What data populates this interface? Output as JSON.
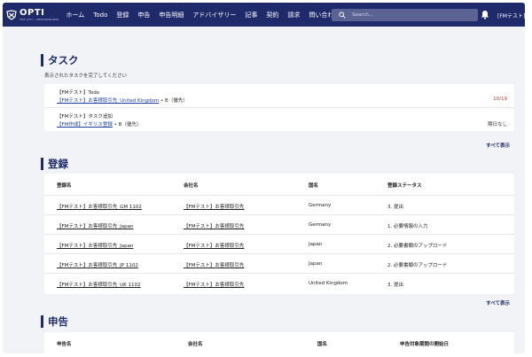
{
  "nav": {
    "logo_word": "OPTI",
    "logo_tagline": "THE CITY • PERFORMANCE",
    "menu": [
      "ホーム",
      "Todo",
      "登録",
      "申告",
      "申告明細",
      "アドバイザリー",
      "記事",
      "契約",
      "請求"
    ],
    "more_label": "問い合わせ",
    "search_placeholder": "Search...",
    "user_label": "[FMテスト]"
  },
  "tasks": {
    "title": "タスク",
    "subtitle": "表示されたタスクを完了してください",
    "items": [
      {
        "title": "【FMテスト】Todo",
        "link": "【FMテスト】お客様取引先_United Kingdom",
        "meta": "• B（優先）",
        "badge": "10/19"
      },
      {
        "title": "【FMテスト】タスク追加",
        "link": "【FM作成】イギリス登録",
        "meta": "• B（優先）",
        "badge": "期日なし"
      }
    ],
    "show_all": "すべて表示"
  },
  "registrations": {
    "title": "登録",
    "headers": [
      "登録名",
      "会社名",
      "国名",
      "登録ステータス"
    ],
    "rows": [
      {
        "name": "【FMテスト】お客様取引先_GM 1102",
        "company": "【FMテスト】お客様取引先",
        "country": "Germany",
        "status": "3. 提出"
      },
      {
        "name": "【FMテスト】お客様取引先_Japan",
        "company": "【FMテスト】お客様取引先",
        "country": "Germany",
        "status": "1. 必要情報の入力"
      },
      {
        "name": "【FMテスト】お客様取引先_Japan",
        "company": "【FMテスト】お客様取引先",
        "country": "Japan",
        "status": "2. 必要書類のアップロード"
      },
      {
        "name": "【FMテスト】お客様取引先_JP 1102",
        "company": "【FMテスト】お客様取引先",
        "country": "Japan",
        "status": "2. 必要書類のアップロード"
      },
      {
        "name": "【FMテスト】お客様取引先_UK 1102",
        "company": "【FMテスト】お客様取引先",
        "country": "United Kingdom",
        "status": "3. 提出"
      }
    ],
    "show_all": "すべて表示"
  },
  "declarations": {
    "title": "申告",
    "headers": [
      "申告名",
      "会社名",
      "国名",
      "申告対象期間の開始日"
    ]
  },
  "colors": {
    "nav": "#1f2a6b",
    "accent": "#1f2a6b",
    "link": "#1f3fa0",
    "due": "#c0392b",
    "bg": "#f2f3f6"
  }
}
